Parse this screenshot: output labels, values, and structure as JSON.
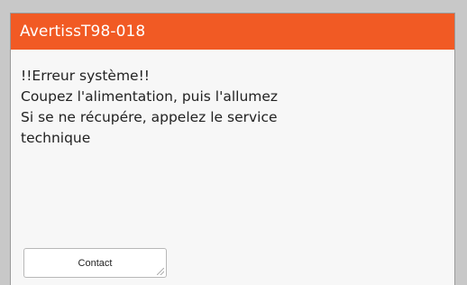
{
  "dialog": {
    "title": "AvertissT98-018",
    "message_lines": [
      "!!Erreur système!!",
      "Coupez l'alimentation, puis l'allumez",
      "Si se ne récupére, appelez le service",
      "technique"
    ],
    "contact_button_label": "Contact",
    "header_color": "#f15a24"
  }
}
